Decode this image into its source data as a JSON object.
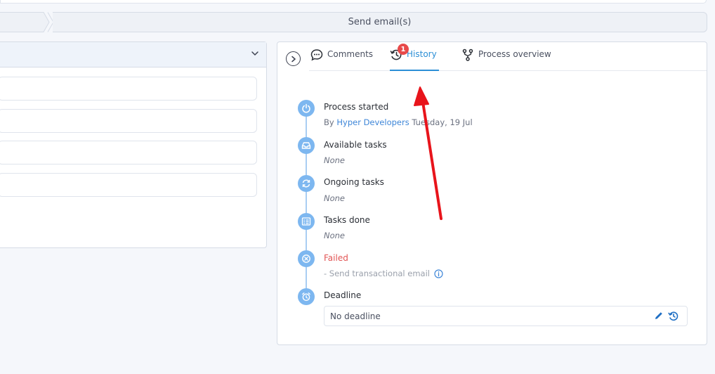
{
  "stepper": {
    "current_step": "Send email(s)"
  },
  "tabs": [
    {
      "label": "Comments",
      "icon": "comment-icon"
    },
    {
      "label": "History",
      "icon": "history-icon",
      "badge": "1",
      "active": true
    },
    {
      "label": "Process overview",
      "icon": "fork-icon"
    }
  ],
  "timeline": {
    "process_started": {
      "title": "Process started",
      "by_prefix": "By",
      "by_user": "Hyper Developers",
      "date": "Tuesday, 19 Jul"
    },
    "available_tasks": {
      "title": "Available tasks",
      "value": "None"
    },
    "ongoing_tasks": {
      "title": "Ongoing tasks",
      "value": "None"
    },
    "tasks_done": {
      "title": "Tasks done",
      "value": "None"
    },
    "failed": {
      "title": "Failed",
      "detail": "- Send transactional email"
    },
    "deadline": {
      "title": "Deadline",
      "value": "No deadline"
    }
  },
  "colors": {
    "accent": "#2c8fd6",
    "timeline_icon": "#7db7f0",
    "failed": "#e25555",
    "badge": "#e84a4a",
    "annotation_arrow": "#e8141b"
  }
}
